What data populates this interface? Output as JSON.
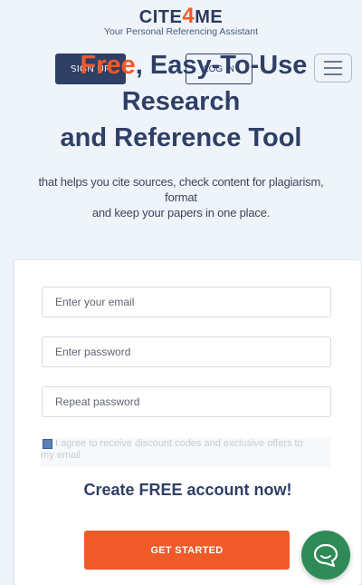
{
  "logo": {
    "prefix": "CITE",
    "accent": "4",
    "suffix": "ME",
    "tagline": "Your Personal Referencing Assistant"
  },
  "nav": {
    "signup_label": "SIGN UP",
    "login_label": "LOG IN",
    "menu_icon": "hamburger-icon"
  },
  "hero": {
    "title_pre": "A ",
    "title_free": "Free",
    "title_line1_rest": ", Easy-To-Use",
    "title_line2": "Research",
    "title_line3": "and Reference Tool",
    "description_line1": "that helps you cite sources, check content for plagiarism,",
    "description_line2": "format",
    "description_line3": "and keep your papers in one place."
  },
  "form": {
    "email_placeholder": "Enter your email",
    "password_placeholder": "Enter password",
    "repeat_password_placeholder": "Repeat password",
    "agree_text": "I agree to receive discount codes and exclusive offers to my email",
    "create_title": "Create FREE account now!",
    "submit_label": "GET STARTED"
  },
  "chat": {
    "icon": "chat-bubble-icon"
  },
  "colors": {
    "background": "#eef4fa",
    "navy": "#2f3f66",
    "accent_orange": "#f05a28",
    "chat_green": "#2e8b57"
  }
}
